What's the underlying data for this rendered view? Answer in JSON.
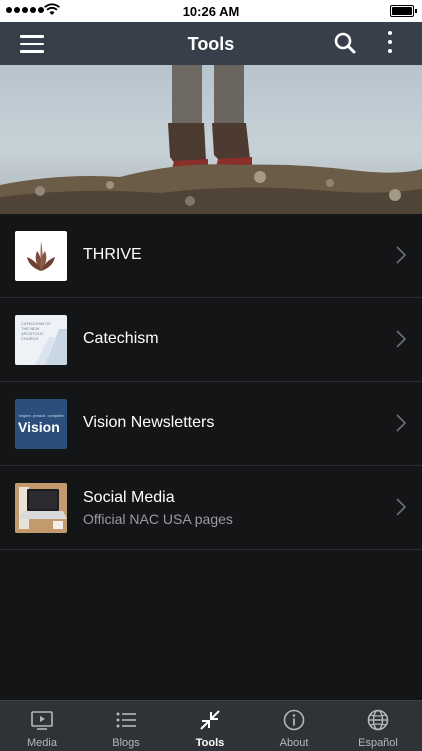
{
  "status_bar": {
    "time": "10:26 AM"
  },
  "nav": {
    "title": "Tools",
    "menu_icon": "hamburger-menu-icon",
    "search_icon": "search-icon",
    "more_icon": "more-vertical-icon",
    "background": "#37404a"
  },
  "hero": {
    "image": "hiker-boots-on-rocky-ground"
  },
  "list": [
    {
      "label": "THRIVE",
      "subtitle": "",
      "thumb": "thrive-logo"
    },
    {
      "label": "Catechism",
      "subtitle": "",
      "thumb": "catechism-cover",
      "thumb_text": "CATECHISM OF THE NEW APOSTOLIC CHURCH"
    },
    {
      "label": "Vision Newsletters",
      "subtitle": "",
      "thumb": "vision-cover",
      "thumb_text": "Vision",
      "thumb_tagline": "inspire. preach. complete."
    },
    {
      "label": "Social Media",
      "subtitle": "Official NAC USA pages",
      "thumb": "laptop-photo"
    }
  ],
  "tabs": [
    {
      "label": "Media",
      "icon": "media-tv-icon"
    },
    {
      "label": "Blogs",
      "icon": "list-icon"
    },
    {
      "label": "Tools",
      "icon": "tools-compress-icon",
      "active": true
    },
    {
      "label": "About",
      "icon": "info-icon"
    },
    {
      "label": "Español",
      "icon": "globe-icon"
    }
  ],
  "colors": {
    "background": "#141517",
    "tab_bar": "#2f3338",
    "accent": "#ffffff"
  }
}
